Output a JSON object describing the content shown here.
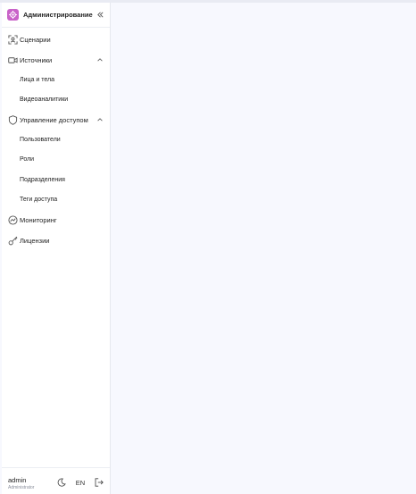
{
  "header": {
    "title": "Администрирование",
    "logo_icon": "gear-icon",
    "collapse_icon": "double-chevron-left-icon"
  },
  "nav": {
    "scenarios": {
      "label": "Сценарии",
      "icon": "scan-icon"
    },
    "sources": {
      "label": "Источники",
      "icon": "video-camera-icon",
      "expanded": true,
      "children": [
        "Лица и тела",
        "Видеоаналитики"
      ]
    },
    "access": {
      "label": "Управление доступом",
      "icon": "shield-icon",
      "expanded": true,
      "children": [
        "Пользователи",
        "Роли",
        "Подразделения",
        "Теги доступа"
      ]
    },
    "monitoring": {
      "label": "Мониторинг",
      "icon": "monitoring-icon"
    },
    "licenses": {
      "label": "Лицензии",
      "icon": "key-icon"
    }
  },
  "footer": {
    "user_name": "admin",
    "user_role": "Administrator",
    "theme_icon": "moon-icon",
    "language": "EN",
    "logout_icon": "logout-icon"
  },
  "colors": {
    "accent": "#c963c9",
    "sidebar_bg": "#ffffff",
    "main_bg": "#f7f8fe"
  }
}
